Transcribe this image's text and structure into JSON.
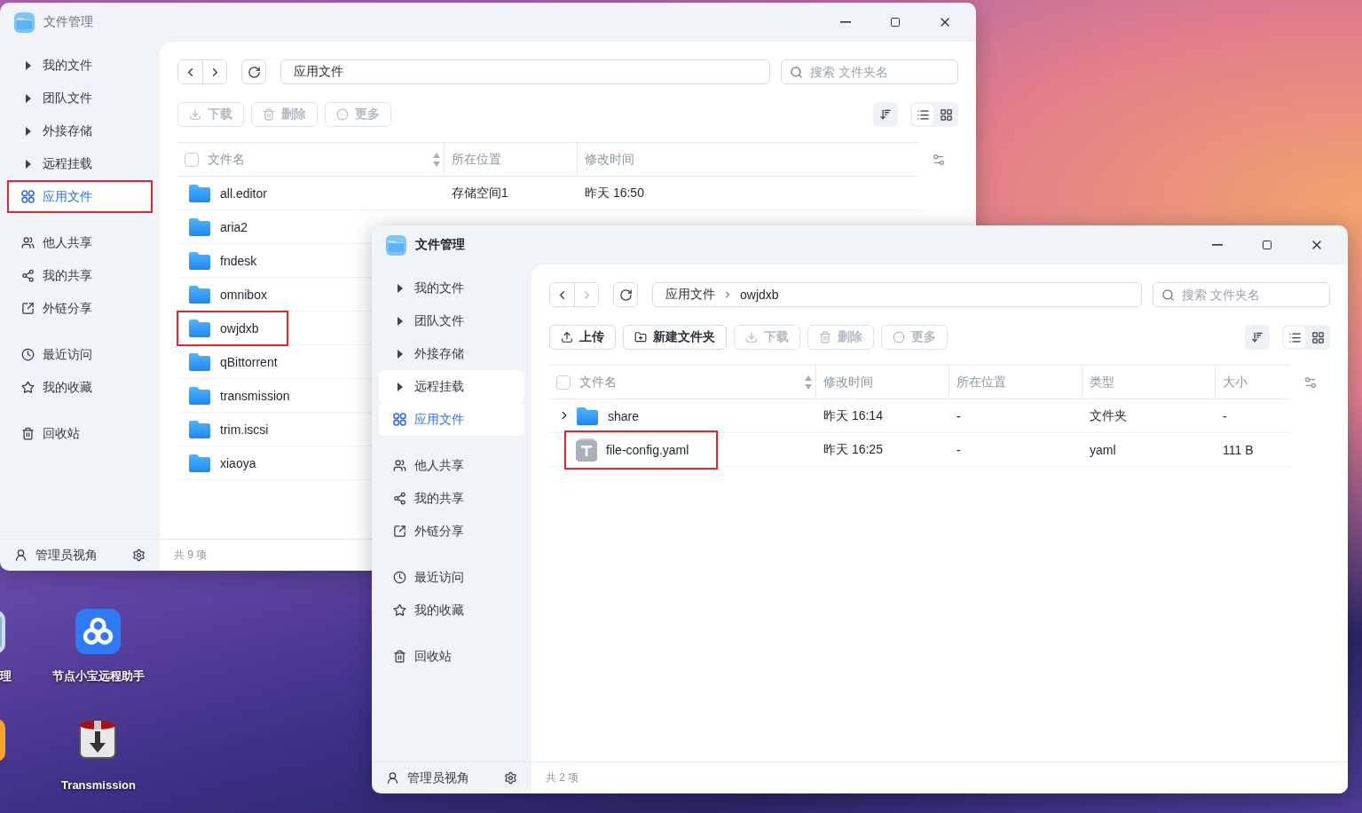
{
  "desktop": {
    "icons": [
      {
        "kind": "partial-gray",
        "label": "理"
      },
      {
        "kind": "partial-orange"
      },
      {
        "kind": "remote",
        "label": "节点小宝远程助手"
      },
      {
        "kind": "transmission",
        "label": "Transmission"
      }
    ]
  },
  "windows": [
    {
      "title": "文件管理",
      "active": false,
      "sidebar": {
        "groups": [
          [
            {
              "label": "我的文件",
              "kind": "tree",
              "selected": false,
              "hovered": false,
              "highlighted": false
            },
            {
              "label": "团队文件",
              "kind": "tree",
              "selected": false,
              "hovered": false,
              "highlighted": false
            },
            {
              "label": "外接存储",
              "kind": "tree",
              "selected": false,
              "hovered": false,
              "highlighted": false
            },
            {
              "label": "远程挂载",
              "kind": "tree",
              "selected": false,
              "hovered": false,
              "highlighted": false
            },
            {
              "label": "应用文件",
              "kind": "link",
              "selected": true,
              "hovered": false,
              "highlighted": true
            }
          ],
          [
            {
              "label": "他人共享",
              "kind": "link",
              "selected": false,
              "hovered": false,
              "highlighted": false
            },
            {
              "label": "我的共享",
              "kind": "link",
              "selected": false,
              "hovered": false,
              "highlighted": false
            },
            {
              "label": "外链分享",
              "kind": "link",
              "selected": false,
              "hovered": false,
              "highlighted": false
            }
          ],
          [
            {
              "label": "最近访问",
              "kind": "link",
              "selected": false,
              "hovered": false,
              "highlighted": false
            },
            {
              "label": "我的收藏",
              "kind": "link",
              "selected": false,
              "hovered": false,
              "highlighted": false
            }
          ],
          [
            {
              "label": "回收站",
              "kind": "link",
              "selected": false,
              "hovered": false,
              "highlighted": false
            }
          ]
        ]
      },
      "nav": [
        {
          "kind": "back",
          "disabled": false
        },
        {
          "kind": "forward",
          "disabled": false
        }
      ],
      "path": [
        "应用文件"
      ],
      "search": {
        "placeholder": "搜索 文件夹名"
      },
      "actions": [
        {
          "kind": "download",
          "label": "下载",
          "disabled": true
        },
        {
          "kind": "delete",
          "label": "删除",
          "disabled": true
        },
        {
          "kind": "more",
          "label": "更多",
          "disabled": true
        }
      ],
      "views": [
        {
          "kind": "list",
          "selected": true
        },
        {
          "kind": "grid",
          "selected": false
        }
      ],
      "table": {
        "checked": false,
        "columns": [
          {
            "label": "文件名",
            "sortable": true
          },
          {
            "label": "所在位置",
            "sortable": false
          },
          {
            "label": "修改时间",
            "sortable": false
          }
        ],
        "rows": [
          {
            "kind": "folder",
            "highlighted": false,
            "cells": [
              "all.editor",
              "存储空间1",
              "昨天 16:50"
            ]
          },
          {
            "kind": "folder",
            "highlighted": false,
            "cells": [
              "aria2"
            ]
          },
          {
            "kind": "folder",
            "highlighted": false,
            "cells": [
              "fndesk"
            ]
          },
          {
            "kind": "folder",
            "highlighted": false,
            "cells": [
              "omnibox"
            ]
          },
          {
            "kind": "folder",
            "highlighted": true,
            "cells": [
              "owjdxb"
            ]
          },
          {
            "kind": "folder",
            "highlighted": false,
            "cells": [
              "qBittorrent"
            ]
          },
          {
            "kind": "folder",
            "highlighted": false,
            "cells": [
              "transmission"
            ]
          },
          {
            "kind": "folder",
            "highlighted": false,
            "cells": [
              "trim.iscsi"
            ]
          },
          {
            "kind": "folder",
            "highlighted": false,
            "cells": [
              "xiaoya"
            ]
          }
        ]
      },
      "footer": {
        "admin_label": "管理员视角",
        "count": "共 9 项"
      }
    },
    {
      "title": "文件管理",
      "active": true,
      "sidebar": {
        "groups": [
          [
            {
              "label": "我的文件",
              "kind": "tree",
              "selected": false,
              "hovered": false,
              "highlighted": false
            },
            {
              "label": "团队文件",
              "kind": "tree",
              "selected": false,
              "hovered": false,
              "highlighted": false
            },
            {
              "label": "外接存储",
              "kind": "tree",
              "selected": false,
              "hovered": false,
              "highlighted": false
            },
            {
              "label": "远程挂载",
              "kind": "tree",
              "selected": false,
              "hovered": true,
              "highlighted": false
            },
            {
              "label": "应用文件",
              "kind": "link",
              "selected": true,
              "hovered": false,
              "highlighted": false
            }
          ],
          [
            {
              "label": "他人共享",
              "kind": "link",
              "selected": false,
              "hovered": false,
              "highlighted": false
            },
            {
              "label": "我的共享",
              "kind": "link",
              "selected": false,
              "hovered": false,
              "highlighted": false
            },
            {
              "label": "外链分享",
              "kind": "link",
              "selected": false,
              "hovered": false,
              "highlighted": false
            }
          ],
          [
            {
              "label": "最近访问",
              "kind": "link",
              "selected": false,
              "hovered": false,
              "highlighted": false
            },
            {
              "label": "我的收藏",
              "kind": "link",
              "selected": false,
              "hovered": false,
              "highlighted": false
            }
          ],
          [
            {
              "label": "回收站",
              "kind": "link",
              "selected": false,
              "hovered": false,
              "highlighted": false
            }
          ]
        ]
      },
      "nav": [
        {
          "kind": "back",
          "disabled": false
        },
        {
          "kind": "forward",
          "disabled": true
        }
      ],
      "path": [
        "应用文件",
        "owjdxb"
      ],
      "search": {
        "placeholder": "搜索 文件夹名"
      },
      "actions": [
        {
          "kind": "upload",
          "label": "上传",
          "disabled": false
        },
        {
          "kind": "new-folder",
          "label": "新建文件夹",
          "disabled": false
        },
        {
          "kind": "download",
          "label": "下载",
          "disabled": true
        },
        {
          "kind": "delete",
          "label": "删除",
          "disabled": true
        },
        {
          "kind": "more",
          "label": "更多",
          "disabled": true
        }
      ],
      "views": [
        {
          "kind": "list",
          "selected": true
        },
        {
          "kind": "grid",
          "selected": false
        }
      ],
      "table": {
        "checked": false,
        "columns": [
          {
            "label": "文件名",
            "sortable": true
          },
          {
            "label": "修改时间",
            "sortable": false
          },
          {
            "label": "所在位置",
            "sortable": false
          },
          {
            "label": "类型",
            "sortable": false
          },
          {
            "label": "大小",
            "sortable": false
          }
        ],
        "rows": [
          {
            "kind": "folder",
            "expandable": true,
            "highlighted": false,
            "cells": [
              "share",
              "昨天 16:14",
              "-",
              "文件夹",
              "-"
            ]
          },
          {
            "kind": "file",
            "expandable": false,
            "highlighted": true,
            "cells": [
              "file-config.yaml",
              "昨天 16:25",
              "-",
              "yaml",
              "111 B"
            ]
          }
        ]
      },
      "footer": {
        "admin_label": "管理员视角",
        "count": "共 2 项"
      }
    }
  ]
}
